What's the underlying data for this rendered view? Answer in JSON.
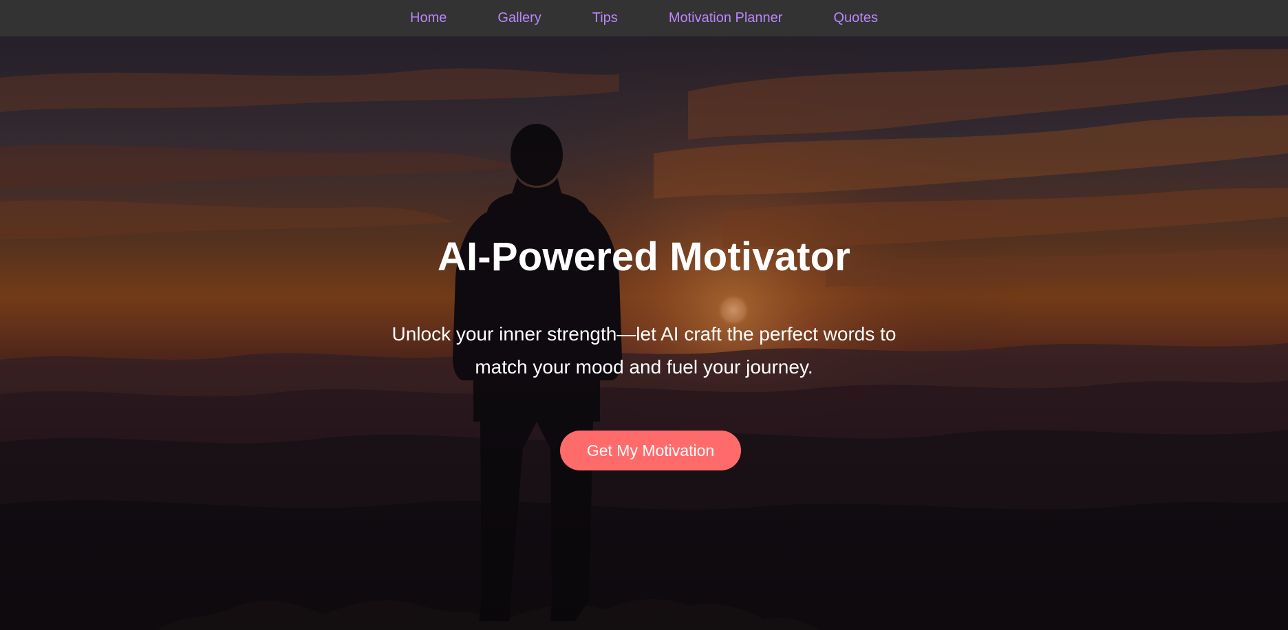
{
  "nav": {
    "items": [
      {
        "label": "Home"
      },
      {
        "label": "Gallery"
      },
      {
        "label": "Tips"
      },
      {
        "label": "Motivation Planner"
      },
      {
        "label": "Quotes"
      }
    ]
  },
  "hero": {
    "background_image": "silhouette of a man standing on a mountain summit at sunset",
    "title": "AI-Powered Motivator",
    "subtitle": "Unlock your inner strength—let AI craft the perfect words to match your mood and fuel your journey.",
    "cta_label": "Get My Motivation"
  },
  "colors": {
    "nav_background": "#333333",
    "nav_link": "#bb86fc",
    "cta_background": "#ff6b6b",
    "hero_text": "#ffffff"
  }
}
